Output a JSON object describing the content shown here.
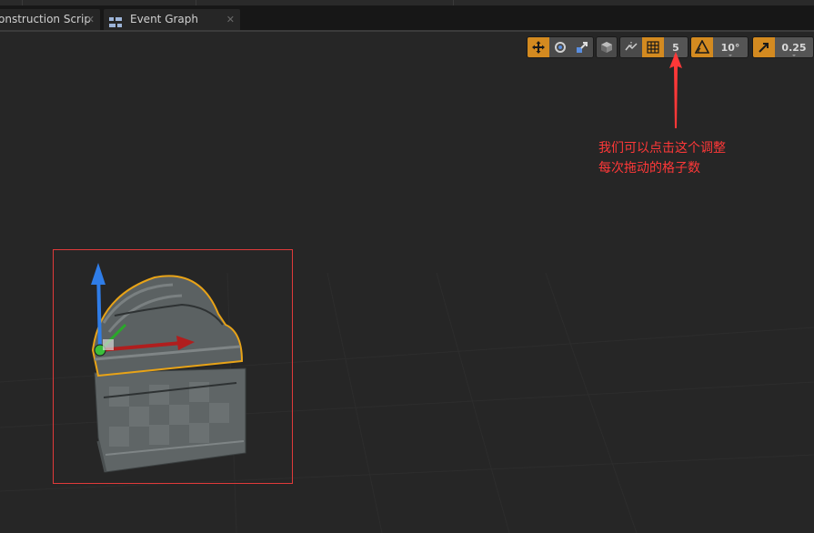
{
  "tabs": [
    {
      "label": "onstruction Scrip",
      "close": "✕"
    },
    {
      "label": "Event Graph",
      "close": "✕"
    }
  ],
  "toolbar": {
    "grid_snap_value": "5",
    "rotation_snap_value": "10°",
    "scale_snap_value": "0.25"
  },
  "annotation": {
    "line1": "我们可以点击这个调整",
    "line2": "每次拖动的格子数",
    "color": "#ff3838"
  },
  "colors": {
    "accent": "#d38a20",
    "viewport_bg": "#262626",
    "selection_outline": "#e8a317",
    "selection_box": "#e03a3a"
  }
}
